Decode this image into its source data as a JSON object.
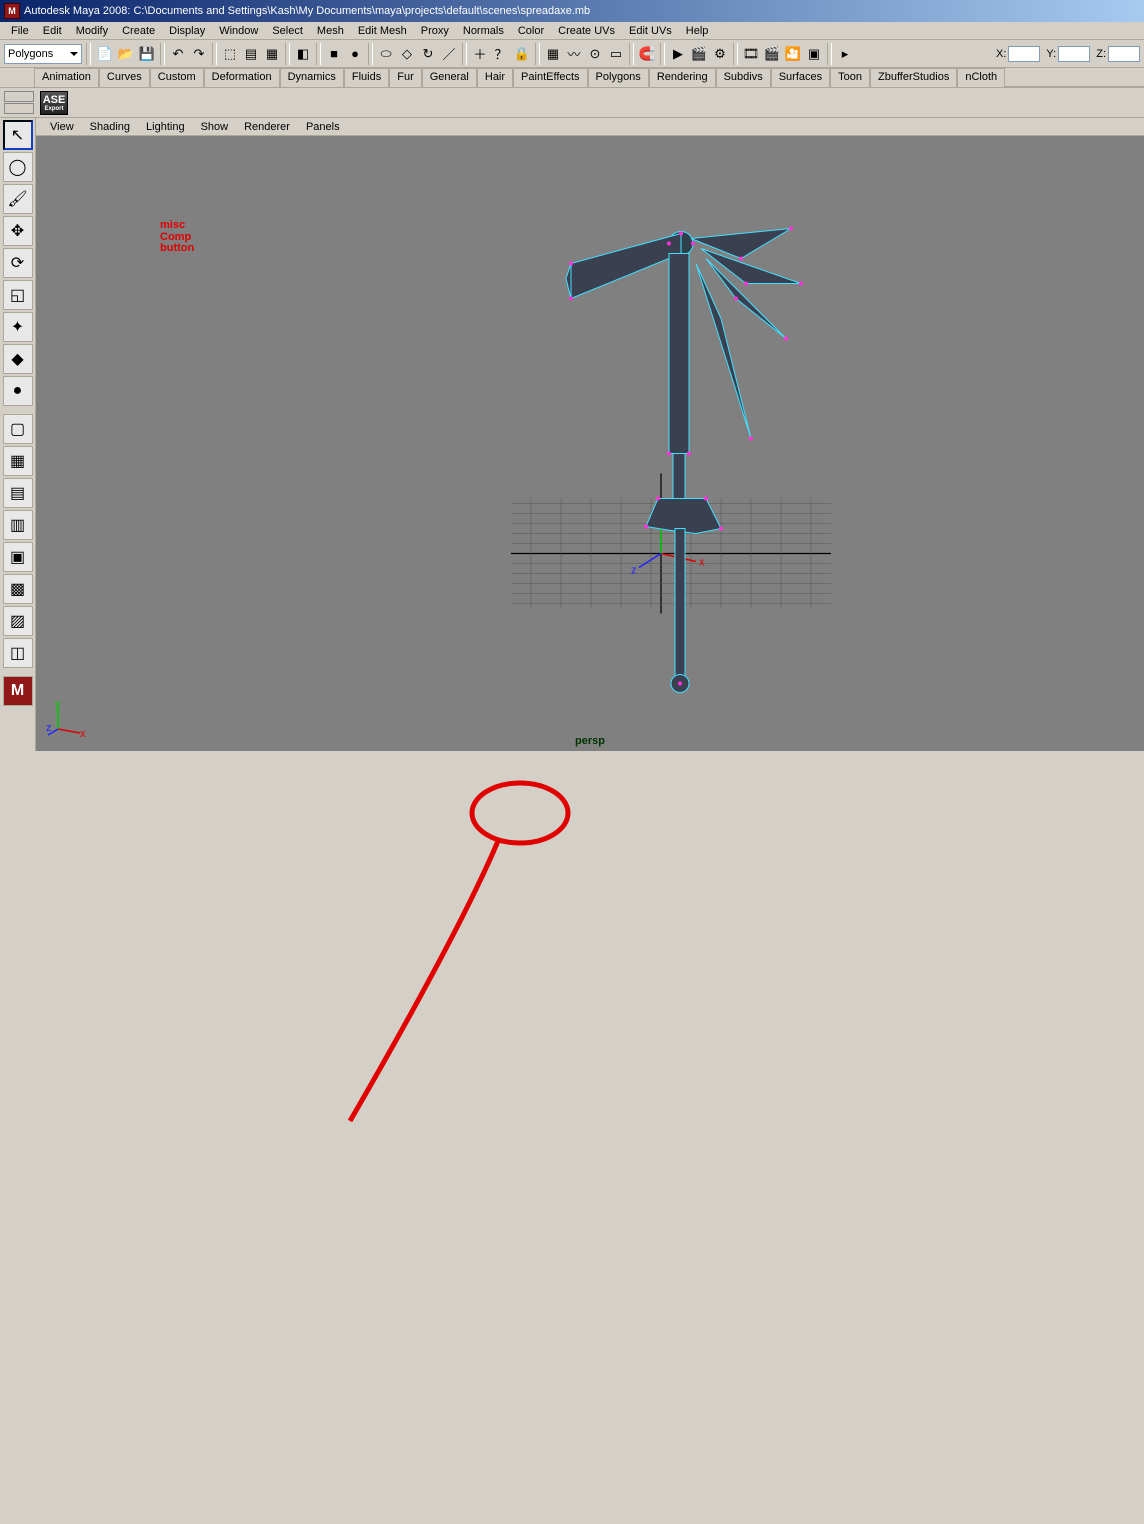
{
  "title": "Autodesk Maya 2008: C:\\Documents and Settings\\Kash\\My Documents\\maya\\projects\\default\\scenes\\spreadaxe.mb",
  "menus": [
    "File",
    "Edit",
    "Modify",
    "Create",
    "Display",
    "Window",
    "Select",
    "Mesh",
    "Edit Mesh",
    "Proxy",
    "Normals",
    "Color",
    "Create UVs",
    "Edit UVs",
    "Help"
  ],
  "mode_dropdown": "Polygons",
  "toolbar_icons": [
    "new",
    "open",
    "save",
    "|",
    "undo",
    "redo",
    "|",
    "sel-hier",
    "sel-obj",
    "sel-comp",
    "|",
    "sel-handle",
    "|",
    "sel-point",
    "sel-face",
    "|",
    "eraser",
    "diamond",
    "rotate",
    "line",
    "|",
    "plus",
    "question",
    "lock",
    "|",
    "snap-grid",
    "snap-curve",
    "snap-point",
    "snap-plane",
    "|",
    "magnet",
    "|",
    "ipr",
    "render",
    "render-globals",
    "|",
    "film",
    "clapper",
    "clapper2",
    "playblast",
    "|",
    "arrow-r"
  ],
  "coord_labels": [
    "X:",
    "Y:",
    "Z:"
  ],
  "shelf_tabs": [
    "Animation",
    "Curves",
    "Custom",
    "Deformation",
    "Dynamics",
    "Fluids",
    "Fur",
    "General",
    "Hair",
    "PaintEffects",
    "Polygons",
    "Rendering",
    "Subdivs",
    "Surfaces",
    "Toon",
    "ZbufferStudios",
    "nCloth"
  ],
  "shelf_ase": "ASE",
  "panel_menus": [
    "View",
    "Shading",
    "Lighting",
    "Show",
    "Renderer",
    "Panels"
  ],
  "viewport_name": "persp",
  "axis_labels": {
    "x": "x",
    "y": "y",
    "z": "z"
  },
  "toolbox_items": [
    "select",
    "lasso",
    "paint-sel",
    "translate",
    "rotate",
    "scale",
    "manip",
    "show-manip",
    "sphere",
    "-",
    "layout-single",
    "layout-four",
    "layout-two-h",
    "layout-two-v",
    "layout-outliner",
    "layout-graph",
    "layout-script",
    "layout-persp",
    "-",
    "maya-logo"
  ],
  "annotation_text": "misc\nComp\nbutton"
}
